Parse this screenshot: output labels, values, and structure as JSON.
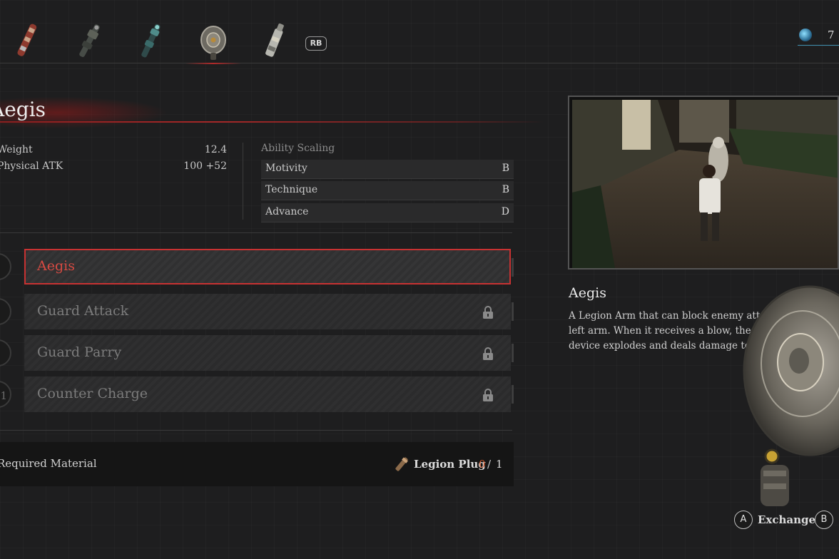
{
  "top_bar": {
    "arm_tabs": [
      {
        "name": "flamberge-arm"
      },
      {
        "name": "puppet-string-arm"
      },
      {
        "name": "fulminis-arm"
      },
      {
        "name": "aegis-arm",
        "active": true
      },
      {
        "name": "deus-arm"
      }
    ],
    "rb_label": "RB",
    "currency_amount": "7"
  },
  "arm": {
    "title": "Aegis",
    "stats": [
      {
        "label": "Weight",
        "value": "12.4"
      },
      {
        "label": "Physical ATK",
        "value": "100 +52"
      }
    ]
  },
  "ability_scaling": {
    "title": "Ability Scaling",
    "rows": [
      {
        "label": "Motivity",
        "grade": "B"
      },
      {
        "label": "Technique",
        "grade": "B"
      },
      {
        "label": "Advance",
        "grade": "D"
      }
    ]
  },
  "skills": [
    {
      "name": "Aegis",
      "level": "",
      "selected": true,
      "locked": false
    },
    {
      "name": "Guard Attack",
      "level": "",
      "selected": false,
      "locked": true
    },
    {
      "name": "Guard Parry",
      "level": "",
      "selected": false,
      "locked": true
    },
    {
      "name": "Counter Charge",
      "level": "1",
      "selected": false,
      "locked": true
    }
  ],
  "material": {
    "label": "Required Material",
    "item_name": "Legion Plug",
    "have": "0",
    "separator": "/",
    "need": "1"
  },
  "description": {
    "title": "Aegis",
    "text": "A Legion Arm that can block enemy attacks with your left arm. When it receives a blow, the embedded device explodes and deals damage to the enemy."
  },
  "buttons": {
    "exchange_key": "A",
    "exchange_label": "Exchange",
    "back_key": "B"
  },
  "colors": {
    "accent_red": "#c83232",
    "material_have": "#d0592c",
    "currency_blue": "#3f8fb0"
  }
}
